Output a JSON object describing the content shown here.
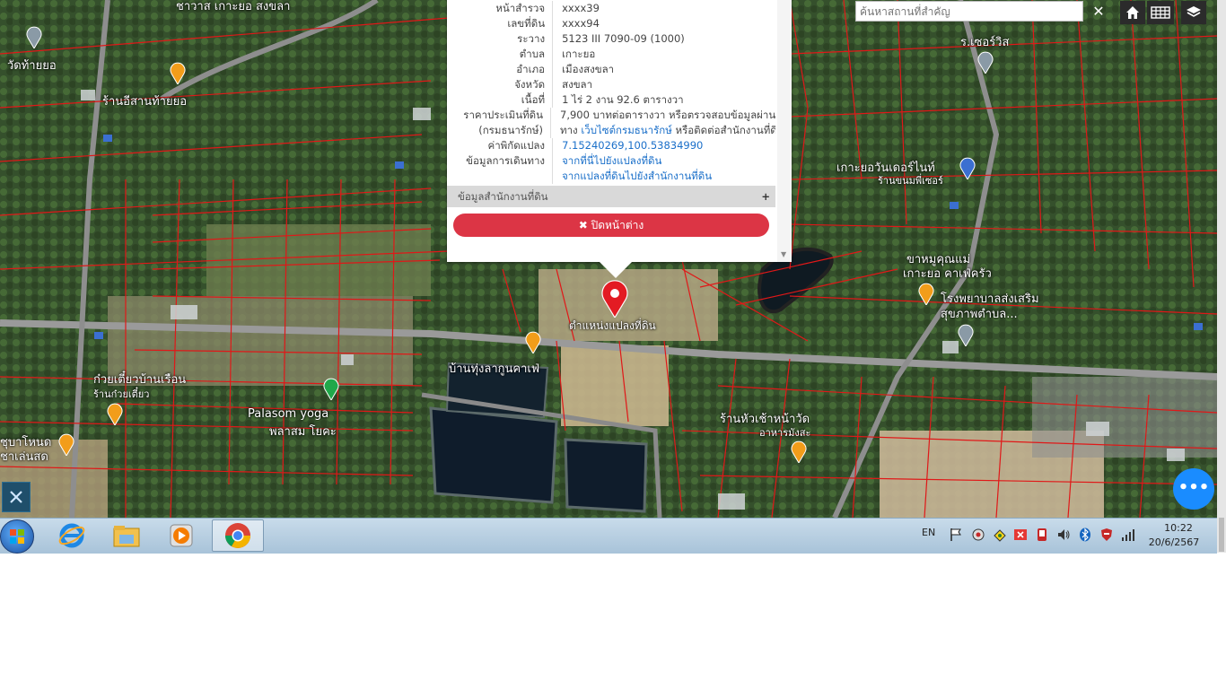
{
  "map": {
    "search_placeholder": "ค้นหาสถานที่สำคัญ",
    "clear_symbol": "✕",
    "tools": {
      "home_icon": "home-icon",
      "grid_icon": "grid-icon",
      "layers_icon": "layers-icon"
    },
    "labels": {
      "wat_tai_yo": "วัดท้ายยอ",
      "ran_nam_tai_yo": "ร้านอีสานท้ายยอ",
      "ran_chao_wit": "ร.เซอร์วิส",
      "ko_yo_wonder": "เกาะยอวันเดอร์ไนท์",
      "ko_yo_wonder_sub": "ร้านขนมพี่เซอร์",
      "khanom_mae": "ขาหมูคุณแม่",
      "khanom_mae2": "เกาะยอ คาเฟ่ครัว",
      "hospital": "โรงพยาบาลส่งเสริม",
      "hospital2": "สุขภาพตำบล...",
      "parcel_label": "ตำแหน่งแปลงที่ดิน",
      "ban_thung_cafe": "บ้านทุ่งลากูนคาเฟ่",
      "kuai_tiao": "ก๋วยเตี๋ยวบ้านเรือน",
      "kuai_tiao_sub": "ร้านก๋วยเตี๋ยว",
      "palasom": "Palasom yoga",
      "palasom_sub": "พลาสม โยคะ",
      "ran_hua": "ร้านหัวเช้าหน้าวัด",
      "ran_hua_sub": "อาหารมังสะ",
      "left_edge": "ชุบาโหนด",
      "left_edge_sub": "ชาเล่นสด",
      "top_label": "ชาวาส เกาะยอ สงขลา"
    }
  },
  "popup": {
    "rows": [
      {
        "key": "หน้าสำรวจ",
        "value": "xxxx39"
      },
      {
        "key": "เลขที่ดิน",
        "value": "xxxx94"
      },
      {
        "key": "ระวาง",
        "value": "5123 III 7090-09 (1000)"
      },
      {
        "key": "ตำบล",
        "value": "เกาะยอ"
      },
      {
        "key": "อำเภอ",
        "value": "เมืองสงขลา"
      },
      {
        "key": "จังหวัด",
        "value": "สงขลา"
      },
      {
        "key": "เนื้อที่",
        "value": "1 ไร่ 2 งาน 92.6 ตารางวา"
      },
      {
        "key": "ราคาประเมินที่ดิน",
        "value": "7,900 บาทต่อตารางวา หรือตรวจสอบข้อมูลผ่าน"
      },
      {
        "key": "(กรมธนารักษ์)",
        "value_prefix": "ทาง ",
        "value_link": "เว็บไซต์กรมธนารักษ์",
        "value_suffix": " หรือติดต่อสำนักงานที่ดิน"
      },
      {
        "key": "ค่าพิกัดแปลง",
        "value_link": "7.15240269,100.53834990"
      },
      {
        "key": "ข้อมูลการเดินทาง",
        "value_link": "จากที่นี่ไปยังแปลงที่ดิน"
      },
      {
        "key": "",
        "value_link": "จากแปลงที่ดินไปยังสำนักงานที่ดิน"
      }
    ],
    "office_section": "ข้อมูลสำนักงานที่ดิน",
    "office_plus": "+",
    "close_label": "✖ ปิดหน้าต่าง"
  },
  "fab_label": "•••",
  "taskbar": {
    "lang": "EN",
    "time": "10:22",
    "date": "20/6/2567",
    "apps": [
      "internet-explorer-icon",
      "file-explorer-icon",
      "media-player-icon",
      "chrome-icon"
    ]
  }
}
